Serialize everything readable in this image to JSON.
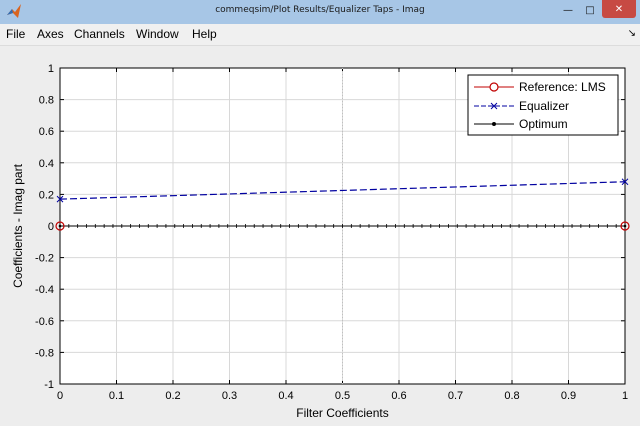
{
  "window": {
    "title": "commeqsim/Plot Results/Equalizer Taps - Imag",
    "icons": {
      "app": "matlab-icon",
      "minimize": "minimize-icon",
      "maximize": "maximize-icon",
      "close": "close-icon",
      "dock": "dock-arrow-icon"
    }
  },
  "menu": {
    "items": [
      {
        "label": "File"
      },
      {
        "label": "Axes"
      },
      {
        "label": "Channels"
      },
      {
        "label": "Window"
      },
      {
        "label": "Help"
      }
    ]
  },
  "chart_data": {
    "type": "line",
    "xlabel": "Filter Coefficients",
    "ylabel": "Coefficients - Imag part",
    "xlim": [
      0,
      1
    ],
    "ylim": [
      -1,
      1
    ],
    "x_ticks": [
      "0",
      "0.1",
      "0.2",
      "0.3",
      "0.4",
      "0.5",
      "0.6",
      "0.7",
      "0.8",
      "0.9",
      "1"
    ],
    "y_ticks": [
      "-1",
      "-0.8",
      "-0.6",
      "-0.4",
      "-0.2",
      "0",
      "0.2",
      "0.4",
      "0.6",
      "0.8",
      "1"
    ],
    "grid": true,
    "legend_position": "top-right",
    "series": [
      {
        "name": "Reference: LMS",
        "color": "#c00000",
        "marker": "circle",
        "x": [
          0,
          1
        ],
        "y": [
          0,
          0
        ]
      },
      {
        "name": "Equalizer",
        "color": "#0000a0",
        "marker": "x",
        "dashed": true,
        "x": [
          0,
          1
        ],
        "y": [
          0.17,
          0.28
        ]
      },
      {
        "name": "Optimum",
        "color": "#000000",
        "marker": "dot",
        "x": [
          0,
          1
        ],
        "y": [
          0,
          0
        ]
      }
    ]
  }
}
